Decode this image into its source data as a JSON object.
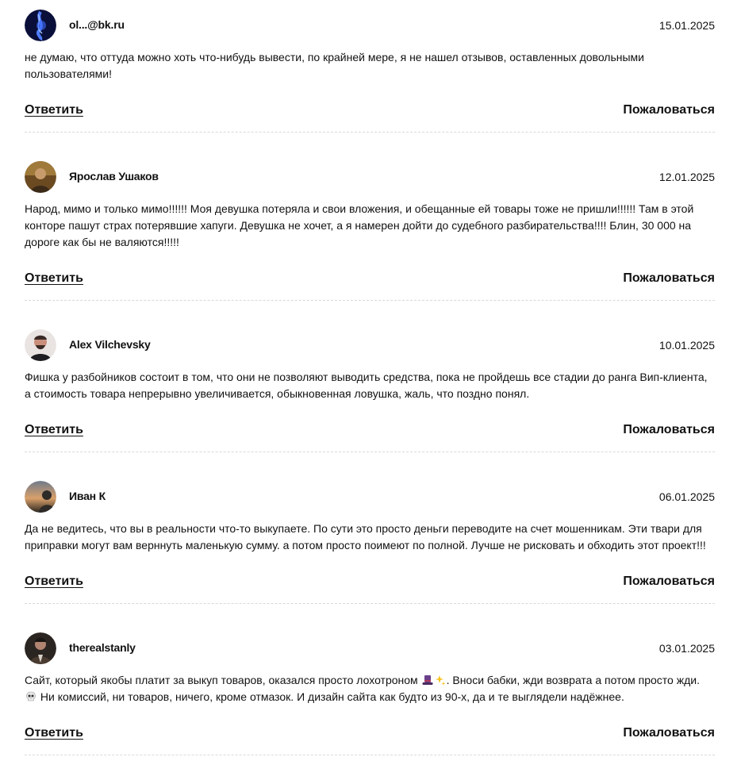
{
  "comments": [
    {
      "author": "ol...@bk.ru",
      "date": "15.01.2025",
      "text": "не думаю, что оттуда можно хоть что-нибудь вывести, по крайней мере, я не нашел отзывов, оставленных довольными пользователями!",
      "reply_label": "Ответить",
      "report_label": "Пожаловаться",
      "avatar_icon": "blue-abstract-avatar"
    },
    {
      "author": "Ярослав Ушаков",
      "date": "12.01.2025",
      "text": "Народ, мимо и только мимо!!!!!! Моя девушка потеряла и свои вложения, и обещанные ей товары тоже не пришли!!!!!! Там в этой конторе пашут страх потерявшие хапуги. Девушка не хочет, а я намерен дойти до судебного разбирательства!!!! Блин, 30 000 на дороге как бы не валяются!!!!!",
      "reply_label": "Ответить",
      "report_label": "Пожаловаться",
      "avatar_icon": "user-photo-avatar"
    },
    {
      "author": "Alex Vilchevsky",
      "date": "10.01.2025",
      "text": "Фишка у разбойников состоит в том, что они не позволяют выводить средства, пока не пройдешь все стадии до ранга Вип-клиента, а стоимость товара непрерывно увеличивается, обыкновенная ловушка, жаль, что поздно понял.",
      "reply_label": "Ответить",
      "report_label": "Пожаловаться",
      "avatar_icon": "user-photo-avatar"
    },
    {
      "author": "Иван К",
      "date": "06.01.2025",
      "text": "Да не ведитесь, что вы в реальности что-то выкупаете. По сути это просто деньги переводите на счет мошенникам. Эти твари для приправки могут вам верннуть маленькую сумму. а потом просто поимеют по полной. Лучше не рисковать и обходить этот проект!!!",
      "reply_label": "Ответить",
      "report_label": "Пожаловаться",
      "avatar_icon": "user-photo-avatar"
    },
    {
      "author": "therealstanly",
      "date": "03.01.2025",
      "text_part1": "Сайт, который якобы платит за выкуп товаров, оказался просто лохотроном ",
      "text_part2": ". Вноси бабки, жди возврата а потом просто жди.",
      "text_part3": " Ни комиссий, ни товаров, ничего, кроме отмазок. И дизайн сайта как будто из 90-х, да и те выглядели надёжнее.",
      "reply_label": "Ответить",
      "report_label": "Пожаловаться",
      "avatar_icon": "user-photo-avatar",
      "emojis": [
        "top-hat-icon",
        "sparkles-icon",
        "skull-icon"
      ]
    }
  ]
}
